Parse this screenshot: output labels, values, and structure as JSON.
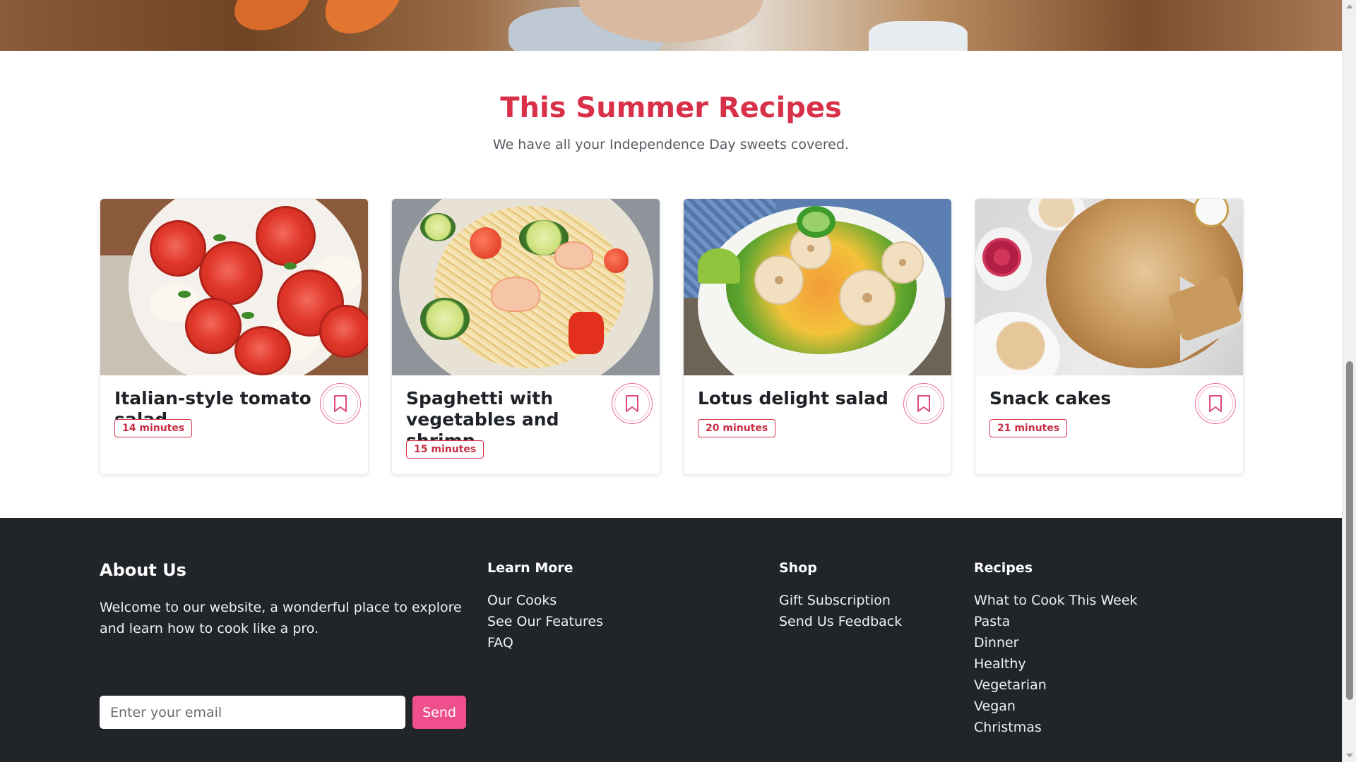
{
  "section": {
    "title": "This Summer Recipes",
    "subtitle": "We have all your Independence Day sweets covered."
  },
  "recipes": [
    {
      "title": "Italian-style tomato salad",
      "time": "14 minutes"
    },
    {
      "title": "Spaghetti with vegetables and shrimp",
      "time": "15 minutes"
    },
    {
      "title": "Lotus delight salad",
      "time": "20 minutes"
    },
    {
      "title": "Snack cakes",
      "time": "21 minutes"
    }
  ],
  "footer": {
    "about": {
      "heading": "About Us",
      "text": "Welcome to our website, a wonderful place to explore and learn how to cook like a pro.",
      "email_placeholder": "Enter your email",
      "send_label": "Send"
    },
    "learn_more": {
      "heading": "Learn More",
      "links": [
        "Our Cooks",
        "See Our Features",
        "FAQ"
      ]
    },
    "shop": {
      "heading": "Shop",
      "links": [
        "Gift Subscription",
        "Send Us Feedback"
      ]
    },
    "recipes": {
      "heading": "Recipes",
      "links": [
        "What to Cook This Week",
        "Pasta",
        "Dinner",
        "Healthy",
        "Vegetarian",
        "Vegan",
        "Christmas"
      ]
    }
  },
  "colors": {
    "accent": "#d9304a",
    "send_button": "#ef4f8d",
    "footer_bg": "#212529"
  },
  "icons": {
    "bookmark": "bookmark-icon"
  }
}
